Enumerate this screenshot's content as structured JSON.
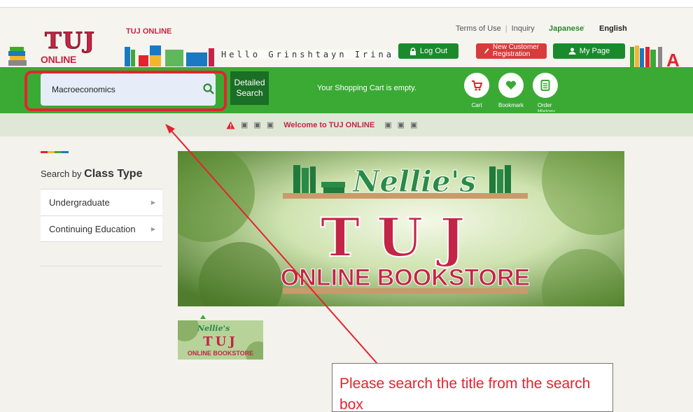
{
  "header": {
    "brand_small": "TUJ ONLINE",
    "logo_top": "TUJ",
    "logo_bottom": "ONLINE BOOKSTORE",
    "terms": "Terms of Use",
    "inquiry": "Inquiry",
    "lang_japanese": "Japanese",
    "lang_english": "English",
    "greeting": "Hello Grinshtayn Irina !",
    "logout": "Log Out",
    "new_customer_line1": "New Customer",
    "new_customer_line2": "Registration",
    "mypage": "My Page"
  },
  "search": {
    "value": "Macroeconomics",
    "detailed_line1": "Detailed",
    "detailed_line2": "Search",
    "cart_message": "Your Shopping Cart is empty."
  },
  "quicklinks": [
    {
      "label": "Cart",
      "icon": "cart-icon"
    },
    {
      "label": "Bookmark",
      "icon": "heart-icon"
    },
    {
      "label": "Order History",
      "icon": "document-icon"
    }
  ],
  "welcome": "Welcome to TUJ ONLINE",
  "sidebar": {
    "title_prefix": "Search by",
    "title_bold": "Class Type",
    "items": [
      {
        "label": "Undergraduate"
      },
      {
        "label": "Continuing Education"
      }
    ]
  },
  "banner": {
    "shop_name": "Nellie's",
    "logo_top": "TUJ",
    "logo_bottom": "ONLINE BOOKSTORE"
  },
  "thumbnail": {
    "shop_name": "Nellie's",
    "logo_top": "TUJ",
    "logo_bottom": "ONLINE BOOKSTORE"
  },
  "annotation": {
    "text": "Please search the title from the search box"
  },
  "colors": {
    "green": "#3aaa35",
    "dark_green": "#1a6e25",
    "brand_red": "#c32546",
    "highlight_red": "#e4232e"
  }
}
